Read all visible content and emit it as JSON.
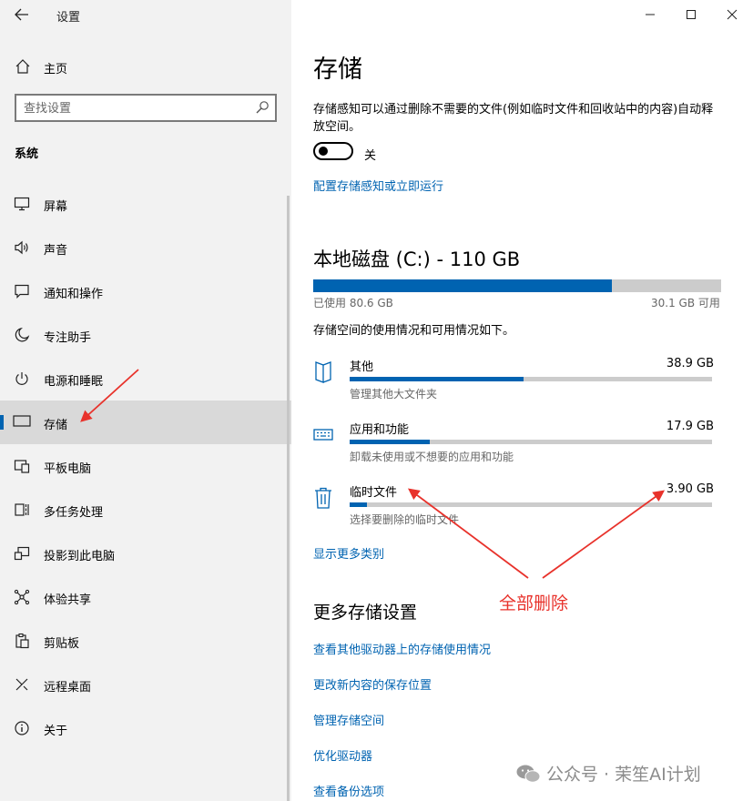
{
  "window": {
    "title": "设置",
    "back_icon": "back-arrow-icon"
  },
  "sidebar": {
    "home_label": "主页",
    "search_placeholder": "查找设置",
    "section_title": "系统",
    "items": [
      {
        "label": "屏幕",
        "icon": "display-icon"
      },
      {
        "label": "声音",
        "icon": "speaker-icon"
      },
      {
        "label": "通知和操作",
        "icon": "notification-icon"
      },
      {
        "label": "专注助手",
        "icon": "moon-icon"
      },
      {
        "label": "电源和睡眠",
        "icon": "power-icon"
      },
      {
        "label": "存储",
        "icon": "storage-icon",
        "active": true
      },
      {
        "label": "平板电脑",
        "icon": "tablet-icon"
      },
      {
        "label": "多任务处理",
        "icon": "multitask-icon"
      },
      {
        "label": "投影到此电脑",
        "icon": "project-icon"
      },
      {
        "label": "体验共享",
        "icon": "share-icon"
      },
      {
        "label": "剪贴板",
        "icon": "clipboard-icon"
      },
      {
        "label": "远程桌面",
        "icon": "remote-icon"
      },
      {
        "label": "关于",
        "icon": "info-icon"
      }
    ],
    "accent_color": "#0063b1"
  },
  "main": {
    "title": "存储",
    "storage_sense_desc": "存储感知可以通过删除不需要的文件(例如临时文件和回收站中的内容)自动释放空间。",
    "toggle_state": "关",
    "configure_link": "配置存储感知或立即运行",
    "disk": {
      "title": "本地磁盘 (C:) - 110 GB",
      "used_label": "已使用 80.6 GB",
      "free_label": "30.1 GB 可用",
      "used_fraction": 0.733
    },
    "usage_info": "存储空间的使用情况和可用情况如下。",
    "categories": [
      {
        "name": "其他",
        "size": "38.9 GB",
        "sub": "管理其他大文件夹",
        "fraction": 0.48,
        "icon": "other-files-icon"
      },
      {
        "name": "应用和功能",
        "size": "17.9 GB",
        "sub": "卸载未使用或不想要的应用和功能",
        "fraction": 0.22,
        "icon": "apps-keyboard-icon"
      },
      {
        "name": "临时文件",
        "size": "3.90 GB",
        "sub": "选择要删除的临时文件",
        "fraction": 0.048,
        "icon": "trash-icon"
      }
    ],
    "show_more_link": "显示更多类别",
    "more_settings_title": "更多存储设置",
    "more_links": [
      "查看其他驱动器上的存储使用情况",
      "更改新内容的保存位置",
      "管理存储空间",
      "优化驱动器",
      "查看备份选项"
    ]
  },
  "annotation": {
    "text": "全部删除",
    "color": "#e8322b"
  },
  "watermark": {
    "text": "公众号 · 茉笙AI计划",
    "icon": "wechat-icon"
  }
}
